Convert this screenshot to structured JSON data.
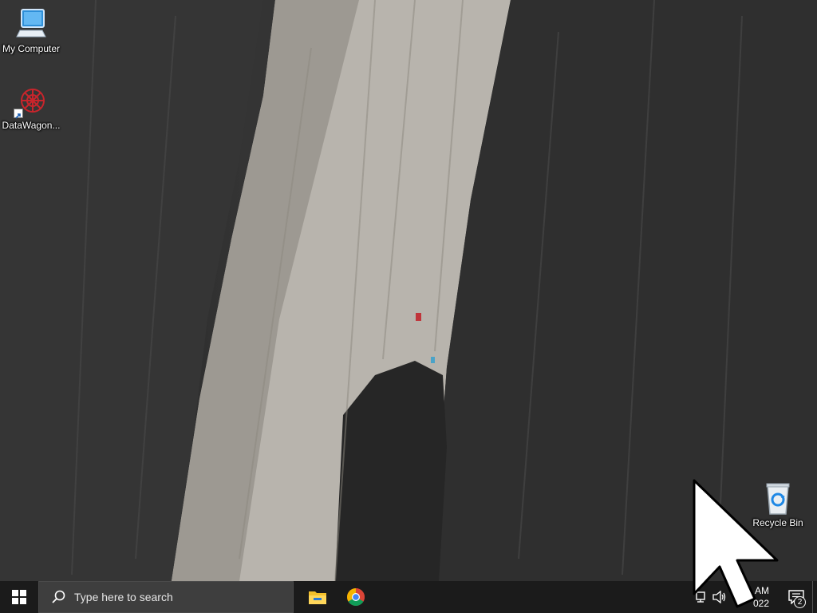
{
  "desktop": {
    "icons": [
      {
        "label": "My Computer"
      },
      {
        "label": "DataWagon..."
      },
      {
        "label": "Recycle Bin"
      }
    ]
  },
  "taskbar": {
    "start_icon": "windows-logo-icon",
    "search": {
      "icon": "search-icon",
      "placeholder": "Type here to search"
    },
    "pinned_apps": [
      {
        "name": "File Explorer",
        "icon": "folder-icon"
      },
      {
        "name": "Google Chrome",
        "icon": "chrome-icon"
      }
    ],
    "tray": {
      "icons": [
        "network-icon",
        "volume-icon"
      ],
      "clock_time": "AM",
      "clock_date": "022",
      "notification_count": "2"
    }
  },
  "colors": {
    "taskbar_bg": "#1b1b1b",
    "search_bg": "#3e3e3e",
    "accent_blue": "#00a4ef"
  }
}
